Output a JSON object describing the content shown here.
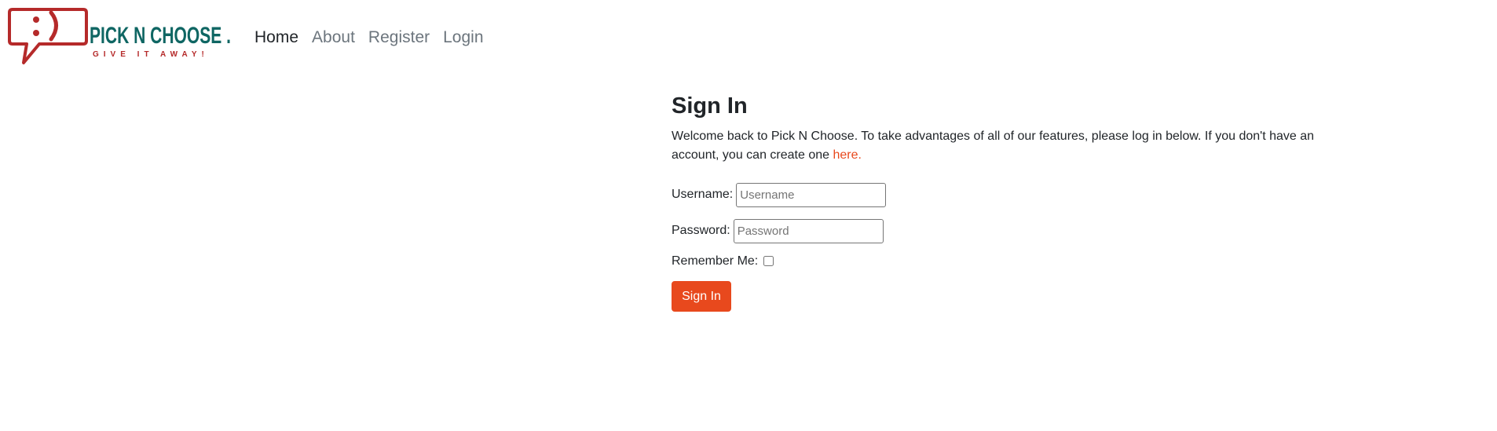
{
  "brand": {
    "name": "PICK N CHOOSE .",
    "tagline": "GIVE IT AWAY!",
    "colors": {
      "teal": "#0f6663",
      "red": "#b52a2a",
      "accent": "#e8491d"
    },
    "icon": "speech-bubble-smiley-icon"
  },
  "nav": {
    "items": [
      {
        "label": "Home",
        "active": true
      },
      {
        "label": "About",
        "active": false
      },
      {
        "label": "Register",
        "active": false
      },
      {
        "label": "Login",
        "active": false
      }
    ]
  },
  "main": {
    "title": "Sign In",
    "intro_text": "Welcome back to Pick N Choose. To take advantages of all of our features, please log in below. If you don't have an account, you can create one ",
    "intro_link": "here."
  },
  "form": {
    "username_label": "Username:",
    "username_placeholder": "Username",
    "password_label": "Password:",
    "password_placeholder": "Password",
    "remember_label": "Remember Me:",
    "remember_checked": false,
    "submit_label": "Sign In"
  }
}
